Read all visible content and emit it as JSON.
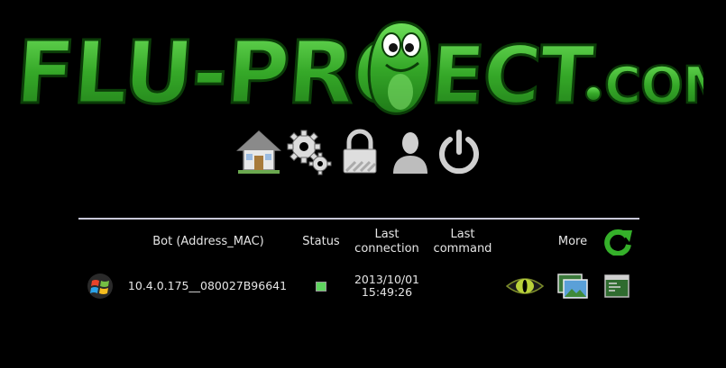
{
  "logo": {
    "text": "FLU-PROJECT.COM"
  },
  "toolbar": {
    "items": [
      {
        "icon": "home-icon"
      },
      {
        "icon": "settings-gears-icon"
      },
      {
        "icon": "lock-icon"
      },
      {
        "icon": "user-icon"
      },
      {
        "icon": "power-icon"
      }
    ]
  },
  "table": {
    "headers": {
      "bot": "Bot (Address_MAC)",
      "status": "Status",
      "last_connection": "Last\nconnection",
      "last_command": "Last\ncommand",
      "more": "More"
    },
    "refresh_icon": "refresh-icon",
    "rows": [
      {
        "os_icon": "windows-icon",
        "bot": "10.4.0.175__080027B96641",
        "status_color": "#5fd45f",
        "last_connection": "2013/10/01\n15:49:26",
        "last_command": "",
        "actions": [
          "eye-icon",
          "screenshot-icon",
          "console-icon"
        ]
      }
    ]
  },
  "colors": {
    "background": "#000000",
    "logo_green": "#3fb52f",
    "divider": "#c8c8d8"
  }
}
